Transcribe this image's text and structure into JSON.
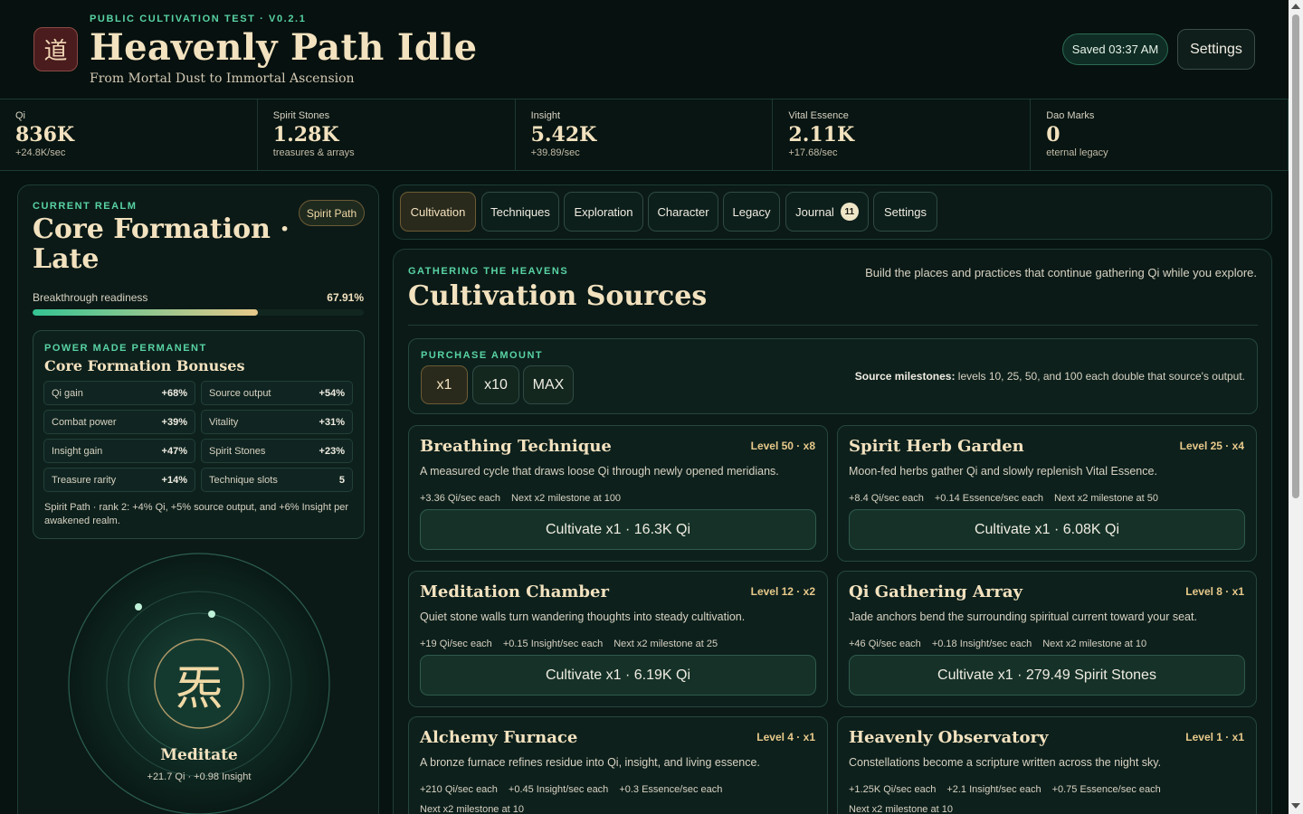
{
  "header": {
    "logo_glyph": "道",
    "eyebrow": "PUBLIC CULTIVATION TEST · V0.2.1",
    "title": "Heavenly Path Idle",
    "subtitle": "From Mortal Dust to Immortal Ascension",
    "saved_label": "Saved 03:37 AM",
    "settings_label": "Settings"
  },
  "resources": [
    {
      "label": "Qi",
      "value": "836K",
      "sub": "+24.8K/sec"
    },
    {
      "label": "Spirit Stones",
      "value": "1.28K",
      "sub": "treasures & arrays"
    },
    {
      "label": "Insight",
      "value": "5.42K",
      "sub": "+39.89/sec"
    },
    {
      "label": "Vital Essence",
      "value": "2.11K",
      "sub": "+17.68/sec"
    },
    {
      "label": "Dao Marks",
      "value": "0",
      "sub": "eternal legacy"
    }
  ],
  "realm": {
    "eyebrow": "CURRENT REALM",
    "path_badge": "Spirit Path",
    "title": "Core Formation · Late",
    "breakthrough_label": "Breakthrough readiness",
    "breakthrough_value": "67.91%",
    "breakthrough_fraction": 0.6791
  },
  "bonuses": {
    "eyebrow": "POWER MADE PERMANENT",
    "title": "Core Formation Bonuses",
    "items": [
      {
        "label": "Qi gain",
        "value": "+68%"
      },
      {
        "label": "Source output",
        "value": "+54%"
      },
      {
        "label": "Combat power",
        "value": "+39%"
      },
      {
        "label": "Vitality",
        "value": "+31%"
      },
      {
        "label": "Insight gain",
        "value": "+47%"
      },
      {
        "label": "Spirit Stones",
        "value": "+23%"
      },
      {
        "label": "Treasure rarity",
        "value": "+14%"
      },
      {
        "label": "Technique slots",
        "value": "5"
      }
    ],
    "note": "Spirit Path · rank 2: +4% Qi, +5% source output, and +6% Insight per awakened realm."
  },
  "meditate": {
    "glyph": "炁",
    "label": "Meditate",
    "sub": "+21.7 Qi · +0.98 Insight"
  },
  "tabs": [
    {
      "label": "Cultivation",
      "active": true
    },
    {
      "label": "Techniques"
    },
    {
      "label": "Exploration"
    },
    {
      "label": "Character"
    },
    {
      "label": "Legacy"
    },
    {
      "label": "Journal",
      "count": "11"
    },
    {
      "label": "Settings"
    }
  ],
  "main": {
    "eyebrow": "GATHERING THE HEAVENS",
    "title": "Cultivation Sources",
    "description": "Build the places and practices that continue gathering Qi while you explore.",
    "purchase_eyebrow": "PURCHASE AMOUNT",
    "amounts": [
      "x1",
      "x10",
      "MAX"
    ],
    "milestone_bold": "Source milestones:",
    "milestone_text": " levels 10, 25, 50, and 100 each double that source's output."
  },
  "sources": [
    {
      "title": "Breathing Technique",
      "level": "Level 50 · x8",
      "desc": "A measured cycle that draws loose Qi through newly opened meridians.",
      "stats": [
        "+3.36 Qi/sec each",
        "Next x2 milestone at 100"
      ],
      "button": "Cultivate x1 · 16.3K Qi"
    },
    {
      "title": "Spirit Herb Garden",
      "level": "Level 25 · x4",
      "desc": "Moon-fed herbs gather Qi and slowly replenish Vital Essence.",
      "stats": [
        "+8.4 Qi/sec each",
        "+0.14 Essence/sec each",
        "Next x2 milestone at 50"
      ],
      "button": "Cultivate x1 · 6.08K Qi"
    },
    {
      "title": "Meditation Chamber",
      "level": "Level 12 · x2",
      "desc": "Quiet stone walls turn wandering thoughts into steady cultivation.",
      "stats": [
        "+19 Qi/sec each",
        "+0.15 Insight/sec each",
        "Next x2 milestone at 25"
      ],
      "button": "Cultivate x1 · 6.19K Qi"
    },
    {
      "title": "Qi Gathering Array",
      "level": "Level 8 · x1",
      "desc": "Jade anchors bend the surrounding spiritual current toward your seat.",
      "stats": [
        "+46 Qi/sec each",
        "+0.18 Insight/sec each",
        "Next x2 milestone at 10"
      ],
      "button": "Cultivate x1 · 279.49 Spirit Stones"
    },
    {
      "title": "Alchemy Furnace",
      "level": "Level 4 · x1",
      "desc": "A bronze furnace refines residue into Qi, insight, and living essence.",
      "stats": [
        "+210 Qi/sec each",
        "+0.45 Insight/sec each",
        "+0.3 Essence/sec each",
        "Next x2 milestone at 10"
      ],
      "button": ""
    },
    {
      "title": "Heavenly Observatory",
      "level": "Level 1 · x1",
      "desc": "Constellations become a scripture written across the night sky.",
      "stats": [
        "+1.25K Qi/sec each",
        "+2.1 Insight/sec each",
        "+0.75 Essence/sec each",
        "Next x2 milestone at 10"
      ],
      "button": ""
    }
  ],
  "colors": {
    "accent_green": "#58d3a4",
    "gold": "#f3e2bf",
    "level_gold": "#e8c98a",
    "bg": "#071311"
  }
}
